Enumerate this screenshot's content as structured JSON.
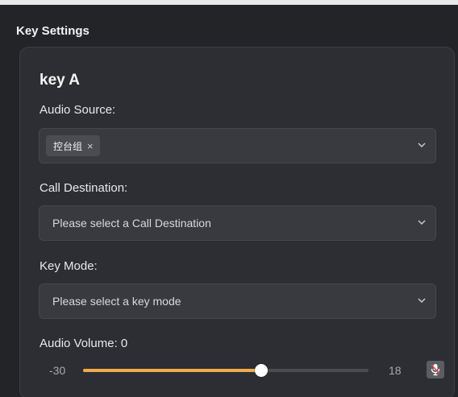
{
  "panel": {
    "title": "Key Settings"
  },
  "card": {
    "title": "key A",
    "audio_source": {
      "label": "Audio Source:",
      "tags": [
        {
          "text": "控台组",
          "remove_icon": "close-icon",
          "remove_glyph": "×"
        }
      ],
      "dropdown_icon": "chevron-down-icon"
    },
    "call_destination": {
      "label": "Call Destination:",
      "placeholder": "Please select a Call Destination",
      "dropdown_icon": "chevron-down-icon"
    },
    "key_mode": {
      "label": "Key Mode:",
      "placeholder": "Please select a key mode",
      "dropdown_icon": "chevron-down-icon"
    },
    "audio_volume": {
      "label": "Audio Volume:  0",
      "value": 0,
      "min": -30,
      "max": 18,
      "min_label": "-30",
      "max_label": "18",
      "mute_icon": "microphone-muted-icon"
    }
  },
  "colors": {
    "accent": "#f0ab4a",
    "background": "#232428",
    "card": "#2d2e33",
    "input": "#383a3f"
  }
}
